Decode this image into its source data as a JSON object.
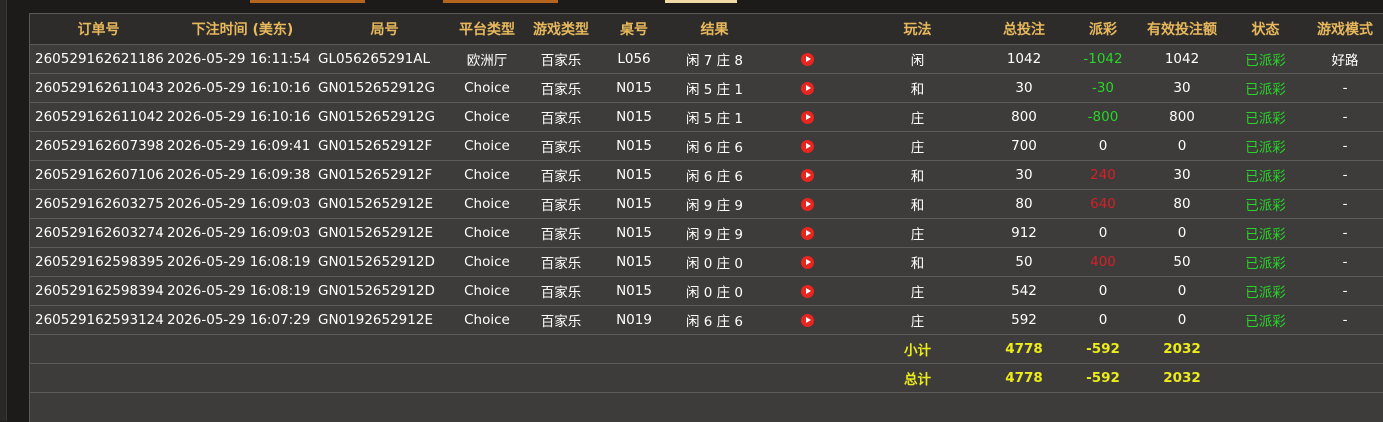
{
  "headers": {
    "order_no": "订单号",
    "bet_time": "下注时间 (美东)",
    "round_no": "局号",
    "platform": "平台类型",
    "game_type": "游戏类型",
    "table_no": "桌号",
    "result": "结果",
    "play": "玩法",
    "total_bet": "总投注",
    "payout": "派彩",
    "valid_bet": "有效投注额",
    "status": "状态",
    "game_mode": "游戏模式"
  },
  "rows": [
    {
      "order_no": "260529162621186",
      "bet_time": "2026-05-29 16:11:54",
      "round_no": "GL056265291AL",
      "platform": "欧洲厅",
      "game_type": "百家乐",
      "table_no": "L056",
      "result": "闲 7 庄 8",
      "play": "闲",
      "total_bet": "1042",
      "payout": "-1042",
      "payout_color": "#28d428",
      "valid_bet": "1042",
      "status": "已派彩",
      "game_mode": "好路"
    },
    {
      "order_no": "260529162611043",
      "bet_time": "2026-05-29 16:10:16",
      "round_no": "GN0152652912G",
      "platform": "Choice",
      "game_type": "百家乐",
      "table_no": "N015",
      "result": "闲 5 庄 1",
      "play": "和",
      "total_bet": "30",
      "payout": "-30",
      "payout_color": "#28d428",
      "valid_bet": "30",
      "status": "已派彩",
      "game_mode": "-"
    },
    {
      "order_no": "260529162611042",
      "bet_time": "2026-05-29 16:10:16",
      "round_no": "GN0152652912G",
      "platform": "Choice",
      "game_type": "百家乐",
      "table_no": "N015",
      "result": "闲 5 庄 1",
      "play": "庄",
      "total_bet": "800",
      "payout": "-800",
      "payout_color": "#28d428",
      "valid_bet": "800",
      "status": "已派彩",
      "game_mode": "-"
    },
    {
      "order_no": "260529162607398",
      "bet_time": "2026-05-29 16:09:41",
      "round_no": "GN0152652912F",
      "platform": "Choice",
      "game_type": "百家乐",
      "table_no": "N015",
      "result": "闲 6 庄 6",
      "play": "庄",
      "total_bet": "700",
      "payout": "0",
      "payout_color": "#ffffff",
      "valid_bet": "0",
      "status": "已派彩",
      "game_mode": "-"
    },
    {
      "order_no": "260529162607106",
      "bet_time": "2026-05-29 16:09:38",
      "round_no": "GN0152652912F",
      "platform": "Choice",
      "game_type": "百家乐",
      "table_no": "N015",
      "result": "闲 6 庄 6",
      "play": "和",
      "total_bet": "30",
      "payout": "240",
      "payout_color": "#d81f26",
      "valid_bet": "30",
      "status": "已派彩",
      "game_mode": "-"
    },
    {
      "order_no": "260529162603275",
      "bet_time": "2026-05-29 16:09:03",
      "round_no": "GN0152652912E",
      "platform": "Choice",
      "game_type": "百家乐",
      "table_no": "N015",
      "result": "闲 9 庄 9",
      "play": "和",
      "total_bet": "80",
      "payout": "640",
      "payout_color": "#d81f26",
      "valid_bet": "80",
      "status": "已派彩",
      "game_mode": "-"
    },
    {
      "order_no": "260529162603274",
      "bet_time": "2026-05-29 16:09:03",
      "round_no": "GN0152652912E",
      "platform": "Choice",
      "game_type": "百家乐",
      "table_no": "N015",
      "result": "闲 9 庄 9",
      "play": "庄",
      "total_bet": "912",
      "payout": "0",
      "payout_color": "#ffffff",
      "valid_bet": "0",
      "status": "已派彩",
      "game_mode": "-"
    },
    {
      "order_no": "260529162598395",
      "bet_time": "2026-05-29 16:08:19",
      "round_no": "GN0152652912D",
      "platform": "Choice",
      "game_type": "百家乐",
      "table_no": "N015",
      "result": "闲 0 庄 0",
      "play": "和",
      "total_bet": "50",
      "payout": "400",
      "payout_color": "#d81f26",
      "valid_bet": "50",
      "status": "已派彩",
      "game_mode": "-"
    },
    {
      "order_no": "260529162598394",
      "bet_time": "2026-05-29 16:08:19",
      "round_no": "GN0152652912D",
      "platform": "Choice",
      "game_type": "百家乐",
      "table_no": "N015",
      "result": "闲 0 庄 0",
      "play": "庄",
      "total_bet": "542",
      "payout": "0",
      "payout_color": "#ffffff",
      "valid_bet": "0",
      "status": "已派彩",
      "game_mode": "-"
    },
    {
      "order_no": "260529162593124",
      "bet_time": "2026-05-29 16:07:29",
      "round_no": "GN0192652912E",
      "platform": "Choice",
      "game_type": "百家乐",
      "table_no": "N019",
      "result": "闲 6 庄 6",
      "play": "庄",
      "total_bet": "592",
      "payout": "0",
      "payout_color": "#ffffff",
      "valid_bet": "0",
      "status": "已派彩",
      "game_mode": "-"
    }
  ],
  "subtotal": {
    "label": "小计",
    "total_bet": "4778",
    "payout": "-592",
    "valid_bet": "2032"
  },
  "grand_total": {
    "label": "总计",
    "total_bet": "4778",
    "payout": "-592",
    "valid_bet": "2032"
  },
  "icons": {
    "replay": "play-video-icon"
  },
  "colors": {
    "header_text": "#e7b85c",
    "positive": "#28d428",
    "negative": "#d81f26",
    "sum_text": "#ecec1a"
  }
}
